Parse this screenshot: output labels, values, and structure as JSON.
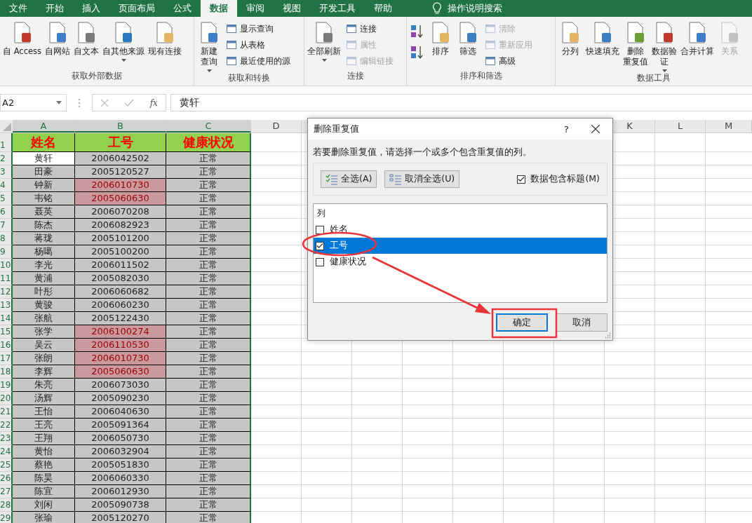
{
  "tabs": [
    {
      "label": "文件",
      "selected": false
    },
    {
      "label": "开始",
      "selected": false
    },
    {
      "label": "插入",
      "selected": false
    },
    {
      "label": "页面布局",
      "selected": false
    },
    {
      "label": "公式",
      "selected": false
    },
    {
      "label": "数据",
      "selected": true
    },
    {
      "label": "审阅",
      "selected": false
    },
    {
      "label": "视图",
      "selected": false
    },
    {
      "label": "开发工具",
      "selected": false
    },
    {
      "label": "帮助",
      "selected": false
    }
  ],
  "tell_me": "操作说明搜索",
  "ribbon_groups": [
    {
      "label": "获取外部数据",
      "items": [
        {
          "kind": "large",
          "lines": [
            "自 Access"
          ],
          "disabled": false,
          "dropdown": false
        },
        {
          "kind": "large",
          "lines": [
            "自网站"
          ],
          "disabled": false,
          "dropdown": false
        },
        {
          "kind": "large",
          "lines": [
            "自文本"
          ],
          "disabled": false,
          "dropdown": false
        },
        {
          "kind": "large",
          "lines": [
            "自其他来源"
          ],
          "disabled": false,
          "dropdown": true
        },
        {
          "kind": "large",
          "lines": [
            "现有连接"
          ],
          "disabled": false,
          "dropdown": false
        }
      ]
    },
    {
      "label": "获取和转换",
      "items": [
        {
          "kind": "large",
          "lines": [
            "新建",
            "查询"
          ],
          "disabled": false,
          "dropdown": true
        },
        {
          "kind": "small",
          "label": "显示查询",
          "disabled": false
        },
        {
          "kind": "small",
          "label": "从表格",
          "disabled": false
        },
        {
          "kind": "small",
          "label": "最近使用的源",
          "disabled": false
        }
      ]
    },
    {
      "label": "连接",
      "items": [
        {
          "kind": "large",
          "lines": [
            "全部刷新"
          ],
          "disabled": false,
          "dropdown": true
        },
        {
          "kind": "small",
          "label": "连接",
          "disabled": false
        },
        {
          "kind": "small",
          "label": "属性",
          "disabled": true
        },
        {
          "kind": "small",
          "label": "编辑链接",
          "disabled": true
        }
      ]
    },
    {
      "label": "排序和筛选",
      "items": [
        {
          "kind": "icon",
          "disabled": false
        },
        {
          "kind": "icon",
          "disabled": false
        },
        {
          "kind": "large",
          "lines": [
            "排序"
          ],
          "disabled": false,
          "dropdown": false
        },
        {
          "kind": "large",
          "lines": [
            "筛选"
          ],
          "disabled": false,
          "dropdown": false
        },
        {
          "kind": "small",
          "label": "清除",
          "disabled": true
        },
        {
          "kind": "small",
          "label": "重新应用",
          "disabled": true
        },
        {
          "kind": "small",
          "label": "高级",
          "disabled": false
        }
      ]
    },
    {
      "label": "数据工具",
      "items": [
        {
          "kind": "large",
          "lines": [
            "分列"
          ],
          "disabled": false,
          "dropdown": false
        },
        {
          "kind": "large",
          "lines": [
            "快速填充"
          ],
          "disabled": false,
          "dropdown": false
        },
        {
          "kind": "large",
          "lines": [
            "删除",
            "重复值"
          ],
          "disabled": false,
          "dropdown": false
        },
        {
          "kind": "large",
          "lines": [
            "数据验",
            "证"
          ],
          "disabled": false,
          "dropdown": true
        },
        {
          "kind": "large",
          "lines": [
            "合并计算"
          ],
          "disabled": false,
          "dropdown": false
        },
        {
          "kind": "large",
          "lines": [
            "关系"
          ],
          "disabled": true,
          "dropdown": false
        }
      ]
    }
  ],
  "formula_bar": {
    "name_box": "A2",
    "fx": "fx",
    "value": "黄轩"
  },
  "columns": [
    {
      "label": "A",
      "selected": true
    },
    {
      "label": "B",
      "selected": true
    },
    {
      "label": "C",
      "selected": true
    },
    {
      "label": "D",
      "selected": false
    },
    {
      "label": "K",
      "selected": false
    },
    {
      "label": "L",
      "selected": false
    },
    {
      "label": "M",
      "selected": false
    }
  ],
  "header_row": {
    "row": "1",
    "cells": [
      "姓名",
      "工号",
      "健康状况"
    ]
  },
  "rows": [
    {
      "row": "2",
      "name": "黄轩",
      "id": "2006042502",
      "status": "正常",
      "duplicate": false,
      "active": true
    },
    {
      "row": "3",
      "name": "田豪",
      "id": "2005120527",
      "status": "正常",
      "duplicate": false,
      "active": false
    },
    {
      "row": "4",
      "name": "钟新",
      "id": "2006010730",
      "status": "正常",
      "duplicate": true,
      "active": false
    },
    {
      "row": "5",
      "name": "韦铭",
      "id": "2005060630",
      "status": "正常",
      "duplicate": true,
      "active": false
    },
    {
      "row": "6",
      "name": "聂英",
      "id": "2006070208",
      "status": "正常",
      "duplicate": false,
      "active": false
    },
    {
      "row": "7",
      "name": "陈杰",
      "id": "2006082923",
      "status": "正常",
      "duplicate": false,
      "active": false
    },
    {
      "row": "8",
      "name": "蒋珑",
      "id": "2005101200",
      "status": "正常",
      "duplicate": false,
      "active": false
    },
    {
      "row": "9",
      "name": "杨噶",
      "id": "2005100200",
      "status": "正常",
      "duplicate": false,
      "active": false
    },
    {
      "row": "10",
      "name": "李光",
      "id": "2006011502",
      "status": "正常",
      "duplicate": false,
      "active": false
    },
    {
      "row": "11",
      "name": "黄浦",
      "id": "2005082030",
      "status": "正常",
      "duplicate": false,
      "active": false
    },
    {
      "row": "12",
      "name": "叶彤",
      "id": "2006060682",
      "status": "正常",
      "duplicate": false,
      "active": false
    },
    {
      "row": "13",
      "name": "黄骏",
      "id": "2006060230",
      "status": "正常",
      "duplicate": false,
      "active": false
    },
    {
      "row": "14",
      "name": "张航",
      "id": "2005122430",
      "status": "正常",
      "duplicate": false,
      "active": false
    },
    {
      "row": "15",
      "name": "张学",
      "id": "2006100274",
      "status": "正常",
      "duplicate": true,
      "active": false
    },
    {
      "row": "16",
      "name": "吴云",
      "id": "2006110530",
      "status": "正常",
      "duplicate": true,
      "active": false
    },
    {
      "row": "17",
      "name": "张朗",
      "id": "2006010730",
      "status": "正常",
      "duplicate": true,
      "active": false
    },
    {
      "row": "18",
      "name": "李辉",
      "id": "2005060630",
      "status": "正常",
      "duplicate": true,
      "active": false
    },
    {
      "row": "19",
      "name": "朱亮",
      "id": "2006073030",
      "status": "正常",
      "duplicate": false,
      "active": false
    },
    {
      "row": "20",
      "name": "汤辉",
      "id": "2005090230",
      "status": "正常",
      "duplicate": false,
      "active": false
    },
    {
      "row": "21",
      "name": "王怡",
      "id": "2006040630",
      "status": "正常",
      "duplicate": false,
      "active": false
    },
    {
      "row": "22",
      "name": "王亮",
      "id": "2005091364",
      "status": "正常",
      "duplicate": false,
      "active": false
    },
    {
      "row": "23",
      "name": "王翔",
      "id": "2006050730",
      "status": "正常",
      "duplicate": false,
      "active": false
    },
    {
      "row": "24",
      "name": "黄怡",
      "id": "2006032904",
      "status": "正常",
      "duplicate": false,
      "active": false
    },
    {
      "row": "25",
      "name": "蔡艳",
      "id": "2005051830",
      "status": "正常",
      "duplicate": false,
      "active": false
    },
    {
      "row": "26",
      "name": "陈昊",
      "id": "2006060330",
      "status": "正常",
      "duplicate": false,
      "active": false
    },
    {
      "row": "27",
      "name": "陈宜",
      "id": "2006012930",
      "status": "正常",
      "duplicate": false,
      "active": false
    },
    {
      "row": "28",
      "name": "刘闲",
      "id": "2005090738",
      "status": "正常",
      "duplicate": false,
      "active": false
    },
    {
      "row": "29",
      "name": "张瑜",
      "id": "2005120270",
      "status": "正常",
      "duplicate": false,
      "active": false
    }
  ],
  "dialog": {
    "title": "删除重复值",
    "help": "?",
    "instruction": "若要删除重复值，请选择一个或多个包含重复值的列。",
    "select_all": "全选(A)",
    "unselect_all": "取消全选(U)",
    "has_headers": {
      "label": "数据包含标题(M)",
      "checked": true
    },
    "list_header": "列",
    "columns": [
      {
        "label": "姓名",
        "checked": false,
        "selected": false
      },
      {
        "label": "工号",
        "checked": true,
        "selected": true
      },
      {
        "label": "健康状况",
        "checked": false,
        "selected": false
      }
    ],
    "ok": "确定",
    "cancel": "取消"
  }
}
